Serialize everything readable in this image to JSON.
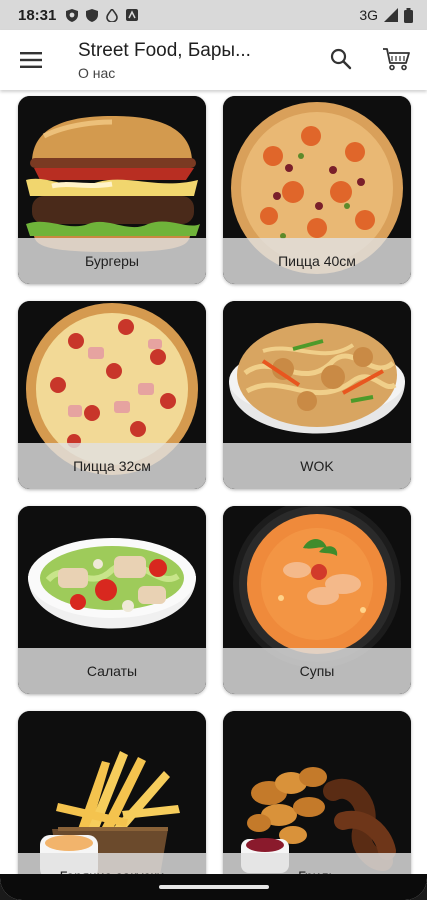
{
  "status_bar": {
    "time": "18:31",
    "network": "3G"
  },
  "app_bar": {
    "title": "Street Food, Бары...",
    "subtitle": "О нас",
    "menu_icon": "hamburger-menu-icon",
    "search_icon": "search-icon",
    "cart_icon": "shopping-cart-icon"
  },
  "categories": [
    {
      "label": "Бургеры"
    },
    {
      "label": "Пицца 40см"
    },
    {
      "label": "Пицца 32см"
    },
    {
      "label": "WOK"
    },
    {
      "label": "Салаты"
    },
    {
      "label": "Супы"
    },
    {
      "label": "Горячие закуски"
    },
    {
      "label": "Гриль"
    }
  ]
}
